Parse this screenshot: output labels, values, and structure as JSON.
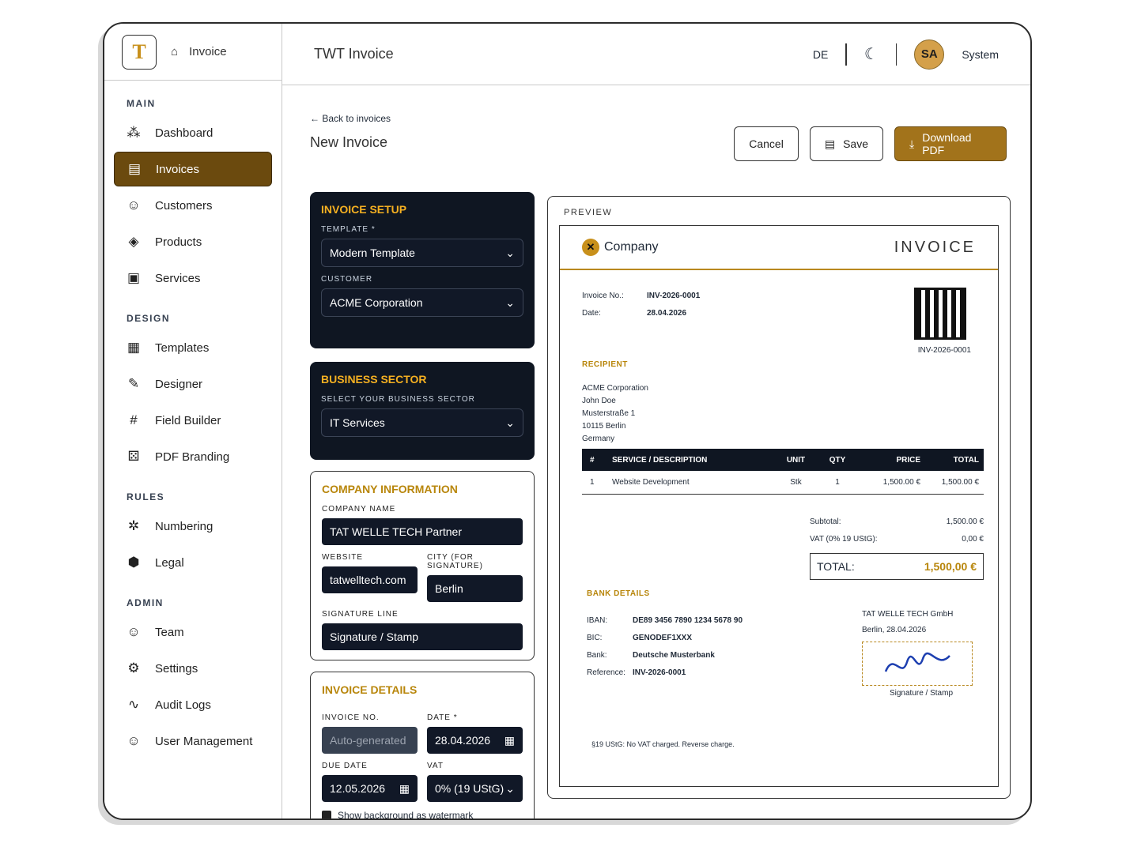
{
  "brand": {
    "logo": "T",
    "breadcrumb": "Invoice"
  },
  "app_title": "TWT Invoice",
  "topbar": {
    "lang": "DE",
    "avatar": "SA",
    "user": "System"
  },
  "nav": {
    "main": "MAIN",
    "dashboard": "Dashboard",
    "invoices": "Invoices",
    "customers": "Customers",
    "products": "Products",
    "services": "Services",
    "design": "DESIGN",
    "templates": "Templates",
    "designer": "Designer",
    "field_builder": "Field Builder",
    "pdf_branding": "PDF Branding",
    "rules": "RULES",
    "numbering": "Numbering",
    "legal": "Legal",
    "admin": "ADMIN",
    "team": "Team",
    "settings": "Settings",
    "audit_logs": "Audit Logs",
    "user_management": "User Management"
  },
  "page": {
    "back": "Back to invoices",
    "title": "New Invoice",
    "cancel": "Cancel",
    "save": "Save",
    "download": "Download PDF"
  },
  "setup": {
    "title": "INVOICE SETUP",
    "template_label": "TEMPLATE *",
    "template": "Modern Template",
    "customer_label": "CUSTOMER",
    "customer": "ACME Corporation"
  },
  "sector": {
    "title": "BUSINESS SECTOR",
    "label": "SELECT YOUR BUSINESS SECTOR",
    "value": "IT Services"
  },
  "company": {
    "title": "COMPANY INFORMATION",
    "name_label": "COMPANY NAME",
    "name": "TAT WELLE TECH Partner",
    "website_label": "WEBSITE",
    "website": "tatwelltech.com",
    "city_label": "CITY (FOR SIGNATURE)",
    "city": "Berlin",
    "sig_label": "SIGNATURE LINE",
    "sig": "Signature / Stamp"
  },
  "details": {
    "title": "INVOICE DETAILS",
    "no_label": "INVOICE NO.",
    "no": "Auto-generated",
    "date_label": "DATE *",
    "date": "28.04.2026",
    "due_label": "DUE DATE",
    "due": "12.05.2026",
    "vat_label": "VAT",
    "vat": "0% (19 UStG)",
    "watermark": "Show background as watermark"
  },
  "preview": {
    "label": "PREVIEW",
    "company": "Company",
    "doc_title": "INVOICE",
    "inv_no_label": "Invoice No.:",
    "inv_no": "INV-2026-0001",
    "date_label": "Date:",
    "date": "28.04.2026",
    "qr_no": "INV-2026-0001",
    "recipient": "RECIPIENT",
    "r1": "ACME Corporation",
    "r2": "John Doe",
    "r3": "Musterstraße 1",
    "r4": "10115 Berlin",
    "r5": "Germany",
    "th": {
      "n": "#",
      "desc": "SERVICE / DESCRIPTION",
      "unit": "UNIT",
      "qty": "QTY",
      "price": "PRICE",
      "total": "TOTAL"
    },
    "row": {
      "n": "1",
      "desc": "Website Development",
      "unit": "Stk",
      "qty": "1",
      "price": "1,500.00 €",
      "total": "1,500.00 €"
    },
    "subtotal_label": "Subtotal:",
    "subtotal": "1,500.00 €",
    "vat_label": "VAT (0% 19 UStG):",
    "vat": "0,00 €",
    "total_label": "TOTAL:",
    "total": "1,500,00 €",
    "bank_title": "BANK DETAILS",
    "iban_l": "IBAN:",
    "iban": "DE89 3456 7890 1234 5678 90",
    "bic_l": "BIC:",
    "bic": "GENODEF1XXX",
    "bank_l": "Bank:",
    "bank": "Deutsche Musterbank",
    "ref_l": "Reference:",
    "ref": "INV-2026-0001",
    "sig_company": "TAT WELLE TECH GmbH",
    "sig_place": "Berlin, 28.04.2026",
    "sig_caption": "Signature / Stamp",
    "note": "§19 UStG: No VAT charged. Reverse charge."
  }
}
